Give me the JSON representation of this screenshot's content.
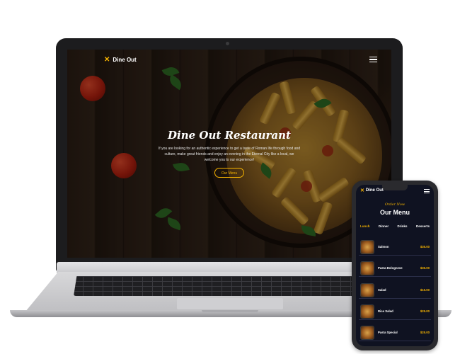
{
  "laptop_site": {
    "logo_text": "Dine Out",
    "hero_title": "Dine Out Restaurant",
    "hero_text": "If you are looking for an authentic experience to get a taste of Roman life through food and culture, make great friends and enjoy an evening in the Eternal City like a local, we welcome you to our experience!",
    "cta_label": "Our Menu"
  },
  "phone_site": {
    "logo_text": "Dine Out",
    "subtitle": "Order Now",
    "title": "Our Menu",
    "tabs": [
      "Lunch",
      "Dinner",
      "Drinks",
      "Desserts"
    ],
    "active_tab": "Lunch",
    "items": [
      {
        "name": "Salmon",
        "price": "$35.00"
      },
      {
        "name": "Pasta Bolognese",
        "price": "$35.00"
      },
      {
        "name": "Salad",
        "price": "$15.00"
      },
      {
        "name": "Rice Salad",
        "price": "$25.00"
      },
      {
        "name": "Pasta Special",
        "price": "$25.00"
      }
    ]
  },
  "colors": {
    "accent": "#f5b301",
    "phone_bg": "#0f1221"
  },
  "icons": {
    "logo": "fork-knife-x-icon",
    "menu": "hamburger-menu-icon"
  }
}
